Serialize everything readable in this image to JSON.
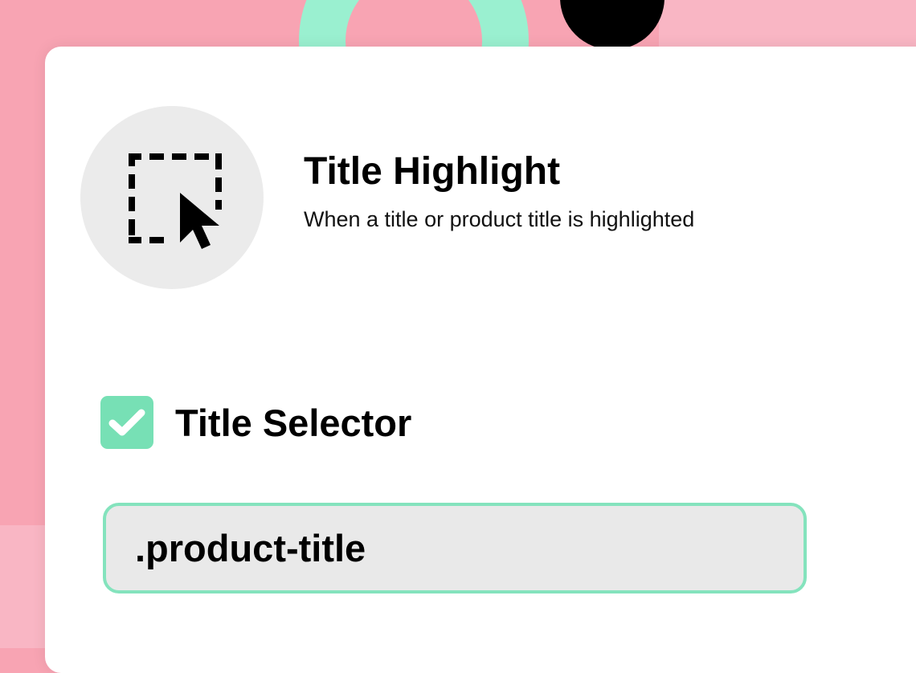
{
  "header": {
    "title": "Title Highlight",
    "subtitle": "When a title or product title is highlighted",
    "icon": "dashed-selection-cursor-icon"
  },
  "selector": {
    "label": "Title Selector",
    "checked": true,
    "value": ".product-title"
  },
  "colors": {
    "accent": "#77e0b5",
    "background_pink": "#f8a4b3",
    "background_pink_light": "#f9b6c4",
    "mint_ring": "#9af0d0",
    "input_border": "#84e3bd"
  }
}
